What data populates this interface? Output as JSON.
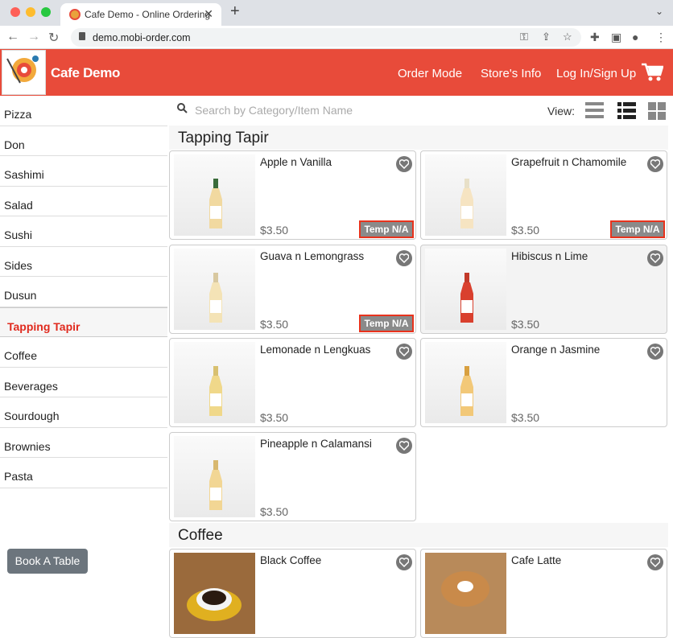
{
  "browser": {
    "tab_title": "Cafe Demo - Online Ordering",
    "tab_close": "✕",
    "new_tab": "+",
    "url": "demo.mobi-order.com",
    "icons": [
      "back-icon",
      "forward-icon",
      "reload-icon",
      "lock-icon",
      "key-icon",
      "share-icon",
      "star-icon",
      "extensions-icon",
      "sidebar-icon",
      "profile-icon",
      "menu-icon"
    ]
  },
  "header": {
    "brand": "Cafe Demo",
    "nav": [
      "Order Mode",
      "Store's Info",
      "Log In/Sign Up"
    ],
    "accent": "#e84b3a"
  },
  "sidebar": {
    "items": [
      "Pizza",
      "Don",
      "Sashimi",
      "Salad",
      "Sushi",
      "Sides",
      "Dusun",
      "Tapping Tapir",
      "Coffee",
      "Beverages",
      "Sourdough",
      "Brownies",
      "Pasta"
    ],
    "active": "Tapping Tapir",
    "book_button": "Book A Table"
  },
  "toolbar": {
    "search_placeholder": "Search by Category/Item Name",
    "view_label": "View:"
  },
  "sections": [
    {
      "title": "Tapping Tapir"
    },
    {
      "title": "Coffee"
    }
  ],
  "products": [
    {
      "name": "Apple n Vanilla",
      "price": "$3.50",
      "badge": "Temp N/A"
    },
    {
      "name": "Grapefruit n Chamomile",
      "price": "$3.50",
      "badge": "Temp N/A"
    },
    {
      "name": "Guava n Lemongrass",
      "price": "$3.50",
      "badge": "Temp N/A"
    },
    {
      "name": "Hibiscus n Lime",
      "price": "$3.50",
      "badge": ""
    },
    {
      "name": "Lemonade n Lengkuas",
      "price": "$3.50",
      "badge": ""
    },
    {
      "name": "Orange n Jasmine",
      "price": "$3.50",
      "badge": ""
    },
    {
      "name": "Pineapple n Calamansi",
      "price": "$3.50",
      "badge": ""
    },
    {
      "name": "Black Coffee",
      "price": "",
      "badge": ""
    },
    {
      "name": "Cafe Latte",
      "price": "",
      "badge": ""
    }
  ],
  "colors": {
    "badge_border": "#e8331d",
    "active_category": "#e02a1e",
    "badge_bg": "#8a8a8a"
  }
}
